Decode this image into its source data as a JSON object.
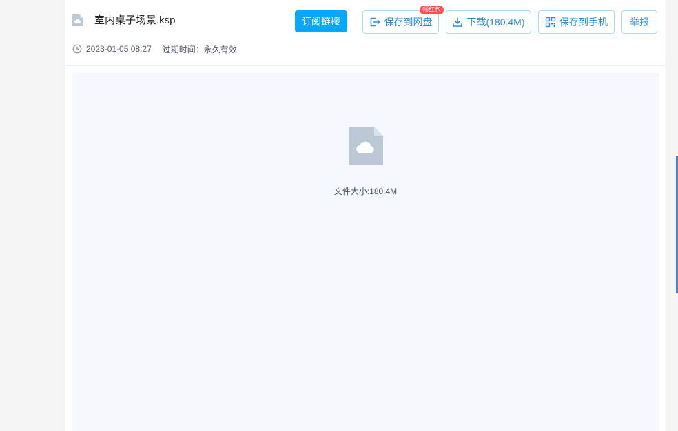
{
  "file": {
    "name": "室内桌子场景.ksp",
    "date": "2023-01-05 08:27",
    "expire": "过期时间：永久有效",
    "size_text": "文件大小:180.4M"
  },
  "actions": {
    "subscribe": "订阅链接",
    "save_to_disk": "保存到网盘",
    "save_badge": "领红包",
    "download": "下载(180.4M)",
    "save_to_phone": "保存到手机",
    "report": "举报"
  },
  "icons": {
    "file": "file-cloud-icon",
    "clock": "clock-icon",
    "save": "save-to-cloud-icon",
    "download": "download-icon",
    "phone": "qr-code-icon",
    "preview": "file-cloud-icon"
  },
  "colors": {
    "accent": "#06a7ff",
    "outline_text": "#2b8fd6",
    "badge": "#ff5050",
    "file_icon": "#bcc8d6"
  }
}
